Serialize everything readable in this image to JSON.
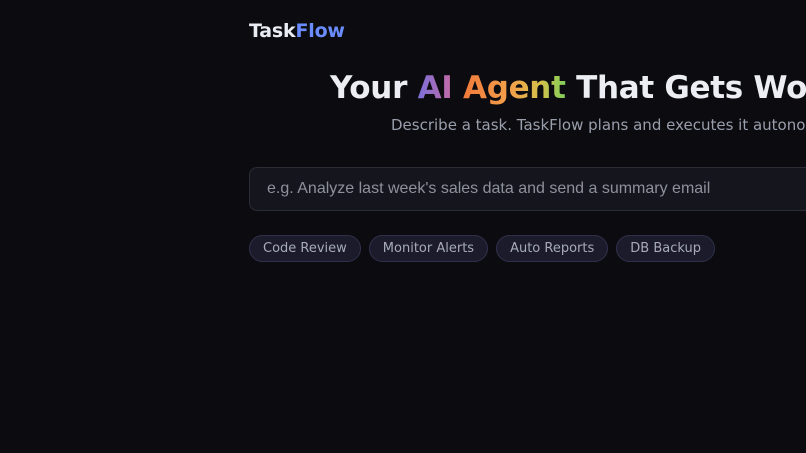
{
  "brand": {
    "part1": "Task",
    "part2": "Flow"
  },
  "hero": {
    "title_lead": "Your ",
    "title_ai": "AI",
    "title_space": " ",
    "title_agent": "Agent",
    "title_rest": " That Gets Work D",
    "subtitle": "Describe a task. TaskFlow plans and executes it autonomousl"
  },
  "task_input": {
    "value": "",
    "placeholder": "e.g. Analyze last week's sales data and send a summary email"
  },
  "suggestions": [
    {
      "label": "Code Review"
    },
    {
      "label": "Monitor Alerts"
    },
    {
      "label": "Auto Reports"
    },
    {
      "label": "DB Backup"
    }
  ],
  "colors": {
    "background": "#0b0b10",
    "brand_accent": "#6b8cff",
    "chip_background": "#1b1b2c"
  }
}
